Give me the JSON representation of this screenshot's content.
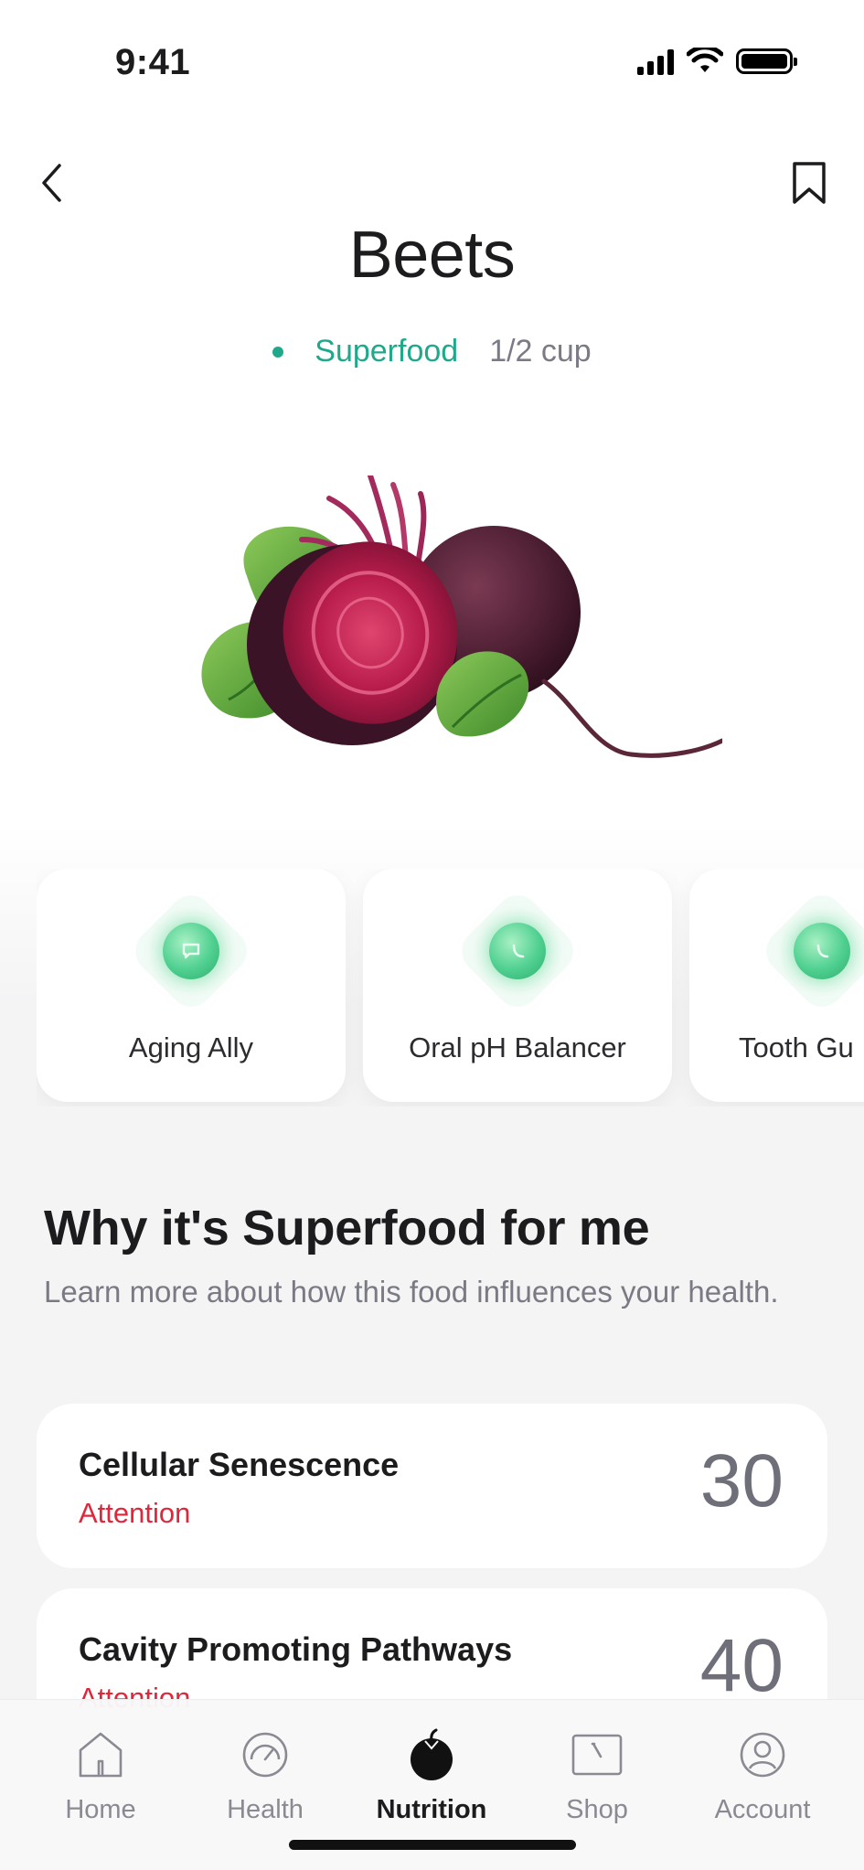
{
  "status_bar": {
    "time": "9:41"
  },
  "food": {
    "name": "Beets",
    "tag": "Superfood",
    "portion": "1/2 cup"
  },
  "benefit_cards": [
    {
      "label": "Aging Ally",
      "icon": "chat-bubble-icon"
    },
    {
      "label": "Oral pH Balancer",
      "icon": "leaf-icon"
    },
    {
      "label": "Tooth Gu",
      "icon": "leaf-icon"
    }
  ],
  "section": {
    "title": "Why it's Superfood for me",
    "subtitle": "Learn more about how this food influences your health."
  },
  "metrics": [
    {
      "name": "Cellular Senescence",
      "status": "Attention",
      "score": "30"
    },
    {
      "name": "Cavity Promoting Pathways",
      "status": "Attention",
      "score": "40"
    }
  ],
  "tabs": [
    {
      "label": "Home",
      "icon": "home-icon"
    },
    {
      "label": "Health",
      "icon": "gauge-icon"
    },
    {
      "label": "Nutrition",
      "icon": "apple-icon",
      "active": true
    },
    {
      "label": "Shop",
      "icon": "shop-icon"
    },
    {
      "label": "Account",
      "icon": "account-icon"
    }
  ],
  "colors": {
    "accent": "#1fa98a",
    "attention": "#e0263a",
    "score": "#6f6f7a"
  }
}
